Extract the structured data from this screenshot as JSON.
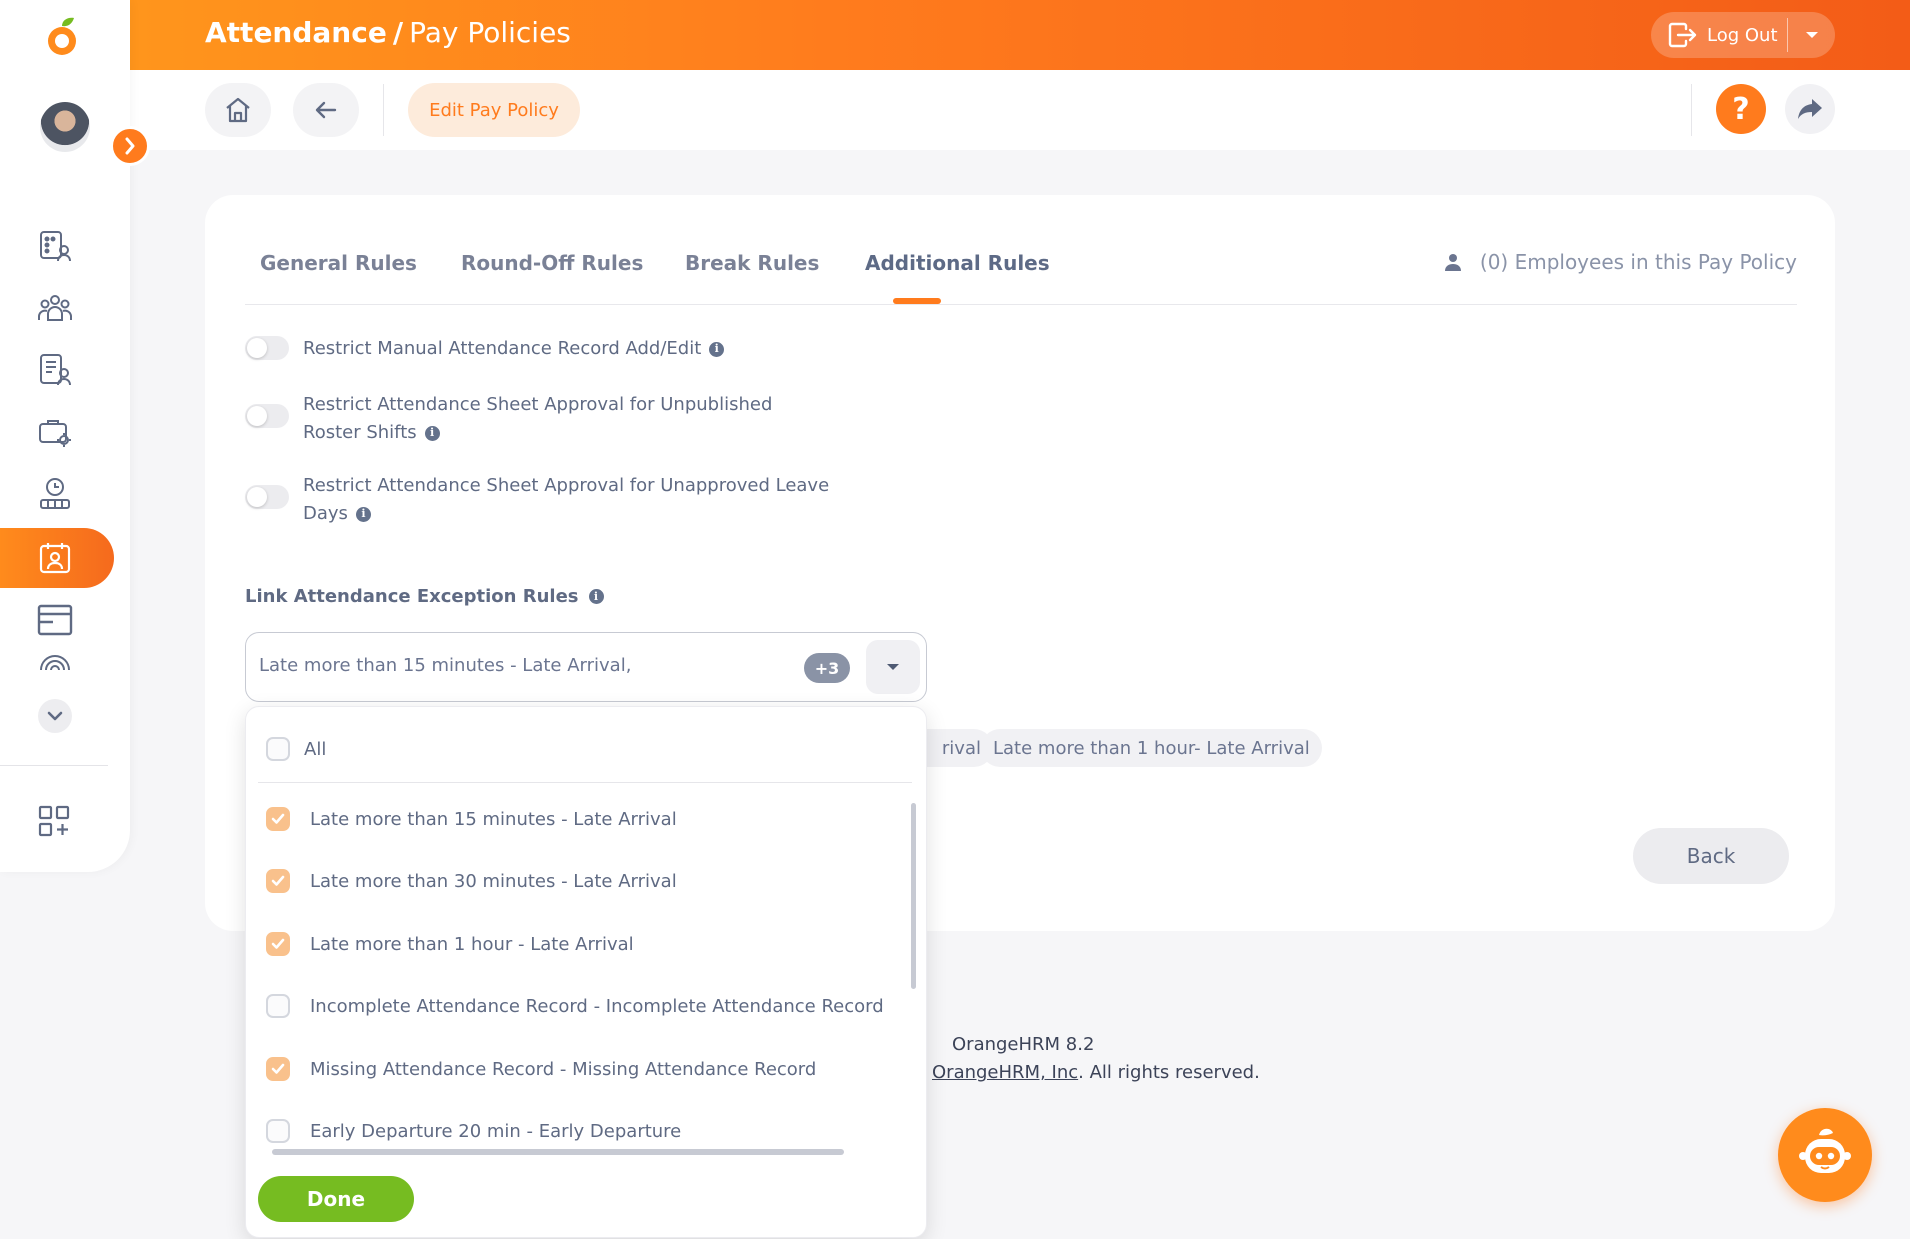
{
  "header": {
    "module": "Attendance",
    "separator": "/",
    "page": "Pay Policies",
    "logout_label": "Log Out"
  },
  "subheader": {
    "edit_label": "Edit Pay Policy",
    "help_symbol": "?"
  },
  "tabs": [
    {
      "label": "General Rules",
      "active": false
    },
    {
      "label": "Round-Off Rules",
      "active": false
    },
    {
      "label": "Break Rules",
      "active": false
    },
    {
      "label": "Additional Rules",
      "active": true
    }
  ],
  "employee_count": "(0) Employees in this Pay Policy",
  "rules": [
    {
      "label": "Restrict Manual Attendance Record Add/Edit",
      "enabled": false
    },
    {
      "label": "Restrict Attendance Sheet Approval for Unpublished Roster Shifts",
      "enabled": false
    },
    {
      "label": "Restrict Attendance Sheet Approval for Unapproved Leave Days",
      "enabled": false
    }
  ],
  "exception_rules": {
    "label": "Link Attendance Exception Rules",
    "selected_text": "Late more than 15 minutes - Late Arrival,",
    "more_count": "+3",
    "chips": [
      "rival",
      "Late more than 1 hour- Late Arrival"
    ]
  },
  "dropdown": {
    "all_label": "All",
    "options": [
      {
        "label": "Late more than 15 minutes - Late Arrival",
        "checked": true
      },
      {
        "label": "Late more than 30 minutes - Late Arrival",
        "checked": true
      },
      {
        "label": "Late more than 1 hour - Late Arrival",
        "checked": true
      },
      {
        "label": "Incomplete Attendance Record - Incomplete Attendance Record",
        "checked": false
      },
      {
        "label": "Missing Attendance Record - Missing Attendance Record",
        "checked": true
      },
      {
        "label": "Early Departure 20 min - Early Departure",
        "checked": false
      }
    ],
    "done_label": "Done"
  },
  "back_label": "Back",
  "footer": {
    "version": "OrangeHRM 8.2",
    "company": "OrangeHRM, Inc",
    "rights": ". All rights reserved."
  },
  "colors": {
    "accent": "#ff7b1d",
    "done_green": "#76bc21",
    "checked_box": "#f9c18c"
  },
  "icons": [
    "orangehrm-logo-icon",
    "logout-icon",
    "chevron-down-icon",
    "home-icon",
    "back-arrow-icon",
    "help-icon",
    "share-icon",
    "chevron-right-icon",
    "person-icon",
    "info-icon",
    "chatbot-icon"
  ]
}
